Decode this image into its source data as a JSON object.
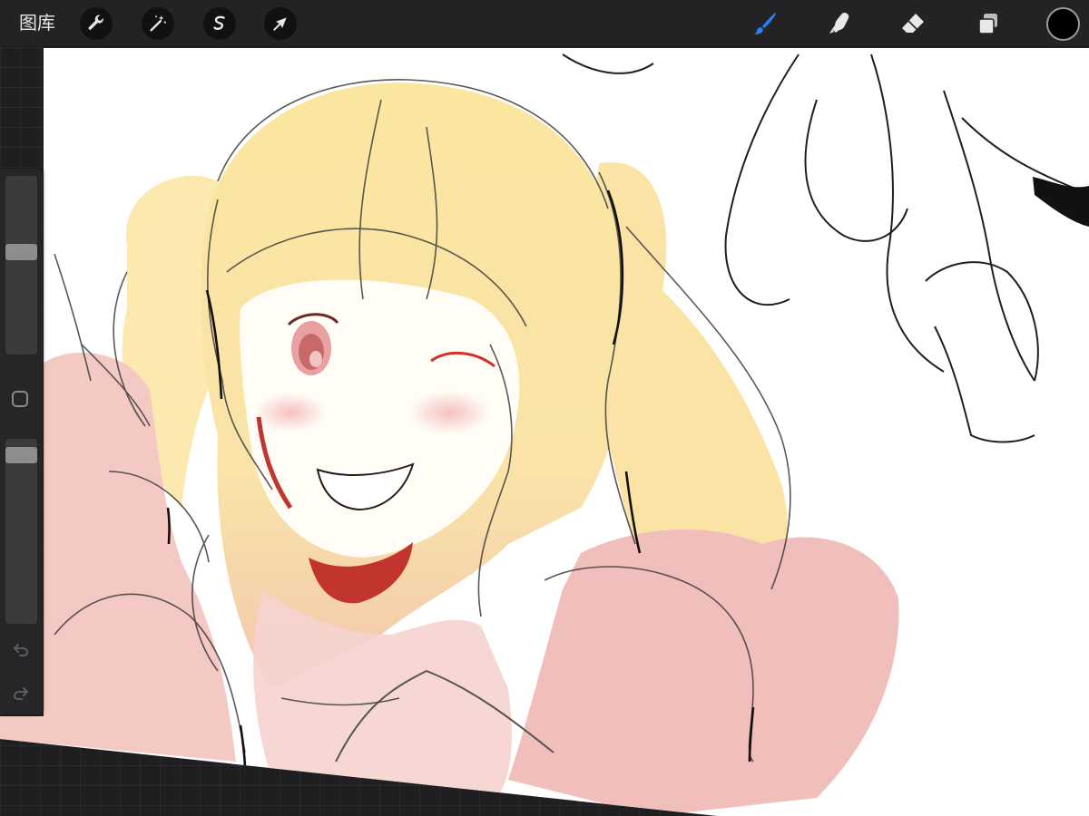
{
  "topbar": {
    "gallery_label": "图库",
    "tools_left": [
      {
        "name": "actions",
        "icon": "wrench-icon"
      },
      {
        "name": "adjustments",
        "icon": "magic-wand-icon"
      },
      {
        "name": "selection",
        "icon": "selection-s-icon"
      },
      {
        "name": "transform",
        "icon": "arrow-cursor-icon"
      }
    ],
    "tools_right": [
      {
        "name": "brush",
        "icon": "brush-icon",
        "active": true
      },
      {
        "name": "smudge",
        "icon": "smudge-finger-icon",
        "active": false
      },
      {
        "name": "eraser",
        "icon": "eraser-icon",
        "active": false
      },
      {
        "name": "layers",
        "icon": "layers-icon",
        "active": false
      }
    ],
    "current_color": "#000000"
  },
  "sidebar": {
    "brush_size_level": 0.58,
    "brush_opacity_level": 0.95,
    "undo_icon": "undo-arrow-icon",
    "redo_icon": "redo-arrow-icon"
  },
  "colors": {
    "accent_blue": "#2f7cf6",
    "icon_light": "#e8e8e8",
    "hair_yellow": "#fbe7a2",
    "jacket_pink": "#f1c0bd",
    "eye_red": "#d0706a",
    "shadow_red": "#c2342e"
  }
}
